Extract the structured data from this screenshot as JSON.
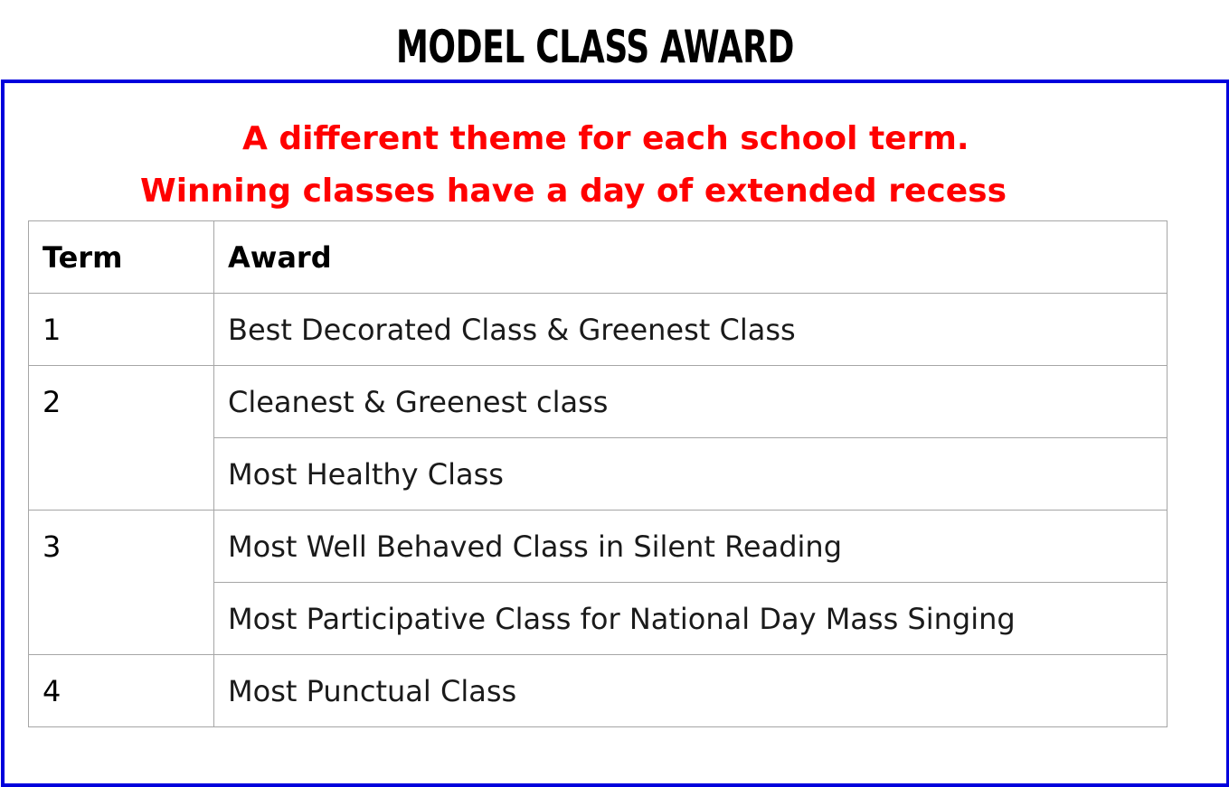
{
  "title": "MODEL CLASS AWARD",
  "subtitle": {
    "line1": "A different theme for each school term.",
    "line2": "Winning classes have a day of extended recess"
  },
  "colors": {
    "border": "#0000dd",
    "subtitle": "#ff0000",
    "grid": "#a6a6a6"
  },
  "table": {
    "headers": {
      "term": "Term",
      "award": "Award"
    },
    "terms": [
      {
        "term": "1",
        "awards": [
          "Best Decorated Class & Greenest Class"
        ]
      },
      {
        "term": "2",
        "awards": [
          "Cleanest & Greenest class",
          "Most Healthy Class"
        ]
      },
      {
        "term": "3",
        "awards": [
          "Most Well Behaved Class in Silent Reading",
          "Most Participative Class for National Day Mass Singing"
        ]
      },
      {
        "term": "4",
        "awards": [
          "Most Punctual Class"
        ]
      }
    ]
  }
}
